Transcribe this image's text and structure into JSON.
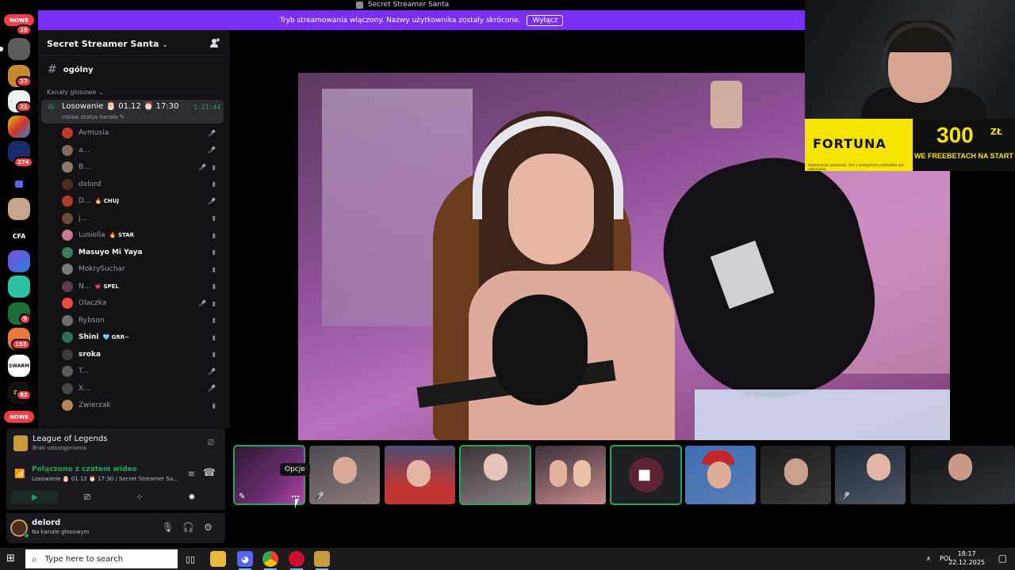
{
  "window": {
    "title": "Secret Streamer Santa"
  },
  "banner": {
    "text": "Tryb streamowania włączony. Nazwy użytkownika zostały skrócone.",
    "button": "Wyłącz"
  },
  "rail": {
    "new_top": "NOWE",
    "new_bottom": "NOWE",
    "badges": [
      "19",
      "27",
      "21",
      "274",
      "9",
      "153",
      "82"
    ],
    "server_labels": {
      "cfa": "CFA",
      "swarm": "SWARM",
      "dpi": "DPI"
    }
  },
  "server": {
    "name": "Secret Streamer Santa",
    "chevron": "⌄"
  },
  "channels": {
    "text_channel": "ogólny",
    "category": "Kanały głosowe",
    "voice": {
      "name": "Losowanie 🎅 01.12 ⏰ 17:30",
      "time": "1:21:44",
      "status": "Ustaw status kanału"
    }
  },
  "members": [
    {
      "name": "Avmusia",
      "tag": "",
      "bright": false,
      "color": "#c0392b",
      "icons": [
        "🎤̸"
      ]
    },
    {
      "name": "a...",
      "tag": "",
      "bright": false,
      "color": "#7f6a5b",
      "icons": [
        "🎤̸"
      ]
    },
    {
      "name": "B...",
      "tag": "",
      "bright": false,
      "color": "#8d7a6a",
      "icons": [
        "🎤̸",
        "▮"
      ]
    },
    {
      "name": "delord",
      "tag": "",
      "bright": false,
      "color": "#4e2a1c",
      "icons": [
        "▮"
      ]
    },
    {
      "name": "D...",
      "tag": "🔥 CHUJ",
      "bright": false,
      "color": "#b03a2e",
      "icons": [
        "🎤̸"
      ]
    },
    {
      "name": "j...",
      "tag": "",
      "bright": false,
      "color": "#6b4b3a",
      "icons": [
        "▮"
      ]
    },
    {
      "name": "Lusiella",
      "tag": "🔥 STAR",
      "bright": false,
      "color": "#c77b96",
      "icons": [
        "▮"
      ]
    },
    {
      "name": "Masuyo Mi Yaya",
      "tag": "",
      "bright": true,
      "color": "#3a7d5c",
      "icons": [
        "▮"
      ]
    },
    {
      "name": "MokrySuchar",
      "tag": "",
      "bright": false,
      "color": "#7a7a7a",
      "icons": [
        "▮"
      ]
    },
    {
      "name": "N...",
      "tag": "💗 SPEL",
      "bright": false,
      "color": "#5c3b4a",
      "icons": [
        "▮"
      ]
    },
    {
      "name": "Olaczka",
      "tag": "",
      "bright": false,
      "color": "#e74c3c",
      "icons": [
        "🎤̸",
        "▮"
      ]
    },
    {
      "name": "Rybson",
      "tag": "",
      "bright": false,
      "color": "#6d6d6d",
      "icons": [
        "▮"
      ]
    },
    {
      "name": "Shini",
      "tag": "🩵 GRR~",
      "bright": true,
      "color": "#2f6f5a",
      "icons": [
        "▮"
      ]
    },
    {
      "name": "sroka",
      "tag": "",
      "bright": true,
      "color": "#3b3b3b",
      "icons": [
        "▮"
      ]
    },
    {
      "name": "T...",
      "tag": "",
      "bright": false,
      "color": "#5a5a5a",
      "icons": [
        "🎤̸"
      ]
    },
    {
      "name": "X...",
      "tag": "",
      "bright": false,
      "color": "#444",
      "icons": [
        "🎤̸"
      ]
    },
    {
      "name": "Zwierzak",
      "tag": "",
      "bright": false,
      "color": "#b5875a",
      "icons": [
        "▮"
      ]
    }
  ],
  "activity": {
    "title": "League of Legends",
    "subtitle": "Brak udostępniania"
  },
  "voice_panel": {
    "title": "Połączono z czatem wideo",
    "subtitle": "Losowanie 🎅 01.12 ⏰ 17:30 / Secret Streamer Sa..."
  },
  "user": {
    "name": "delord",
    "status": "Na kanale głosowym"
  },
  "overlay": {
    "brand": "FORTUNA",
    "amount": "300",
    "currency": "ZŁ",
    "line": "WE FREEBETACH NA START",
    "fine_print": "Hazard może uzależniać. Gra u nielegalnych podmiotów jest zabroniona."
  },
  "strip": {
    "tooltip": "Opcje",
    "more": "⋯"
  },
  "taskbar": {
    "search_placeholder": "Type here to search",
    "lang": "POL",
    "time": "18:17",
    "date": "22.12.2025"
  },
  "colors": {
    "accent": "#7a2ff5",
    "green": "#23a55a",
    "red": "#f23f43"
  }
}
